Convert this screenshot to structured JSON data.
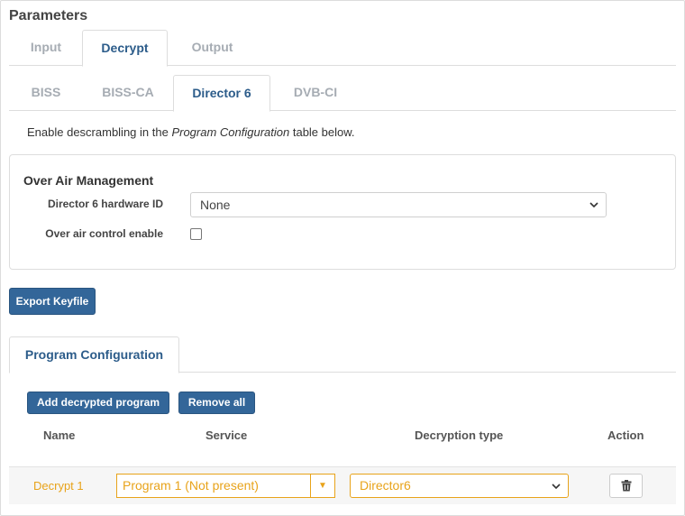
{
  "page": {
    "title": "Parameters"
  },
  "main_tabs": [
    {
      "label": "Input",
      "active": false
    },
    {
      "label": "Decrypt",
      "active": true
    },
    {
      "label": "Output",
      "active": false
    }
  ],
  "decrypt_tabs": [
    {
      "label": "BISS",
      "active": false
    },
    {
      "label": "BISS-CA",
      "active": false
    },
    {
      "label": "Director 6",
      "active": true
    },
    {
      "label": "DVB-CI",
      "active": false
    }
  ],
  "hint": {
    "before": "Enable descrambling in the ",
    "emphasis": "Program Configuration",
    "after": " table below."
  },
  "over_air": {
    "title": "Over Air Management",
    "hardware_id_label": "Director 6 hardware ID",
    "hardware_id_value": "None",
    "control_enable_label": "Over air control enable",
    "control_enable_checked": false
  },
  "buttons": {
    "export": "Export Keyfile",
    "add": "Add decrypted program",
    "remove_all": "Remove all"
  },
  "program_tab": {
    "label": "Program Configuration"
  },
  "table": {
    "headers": {
      "name": "Name",
      "service": "Service",
      "decryption_type": "Decryption type",
      "action": "Action"
    },
    "rows": [
      {
        "name": "Decrypt 1",
        "service": "Program 1 (Not present)",
        "decryption_type": "Director6",
        "action_icon": "trash-icon"
      }
    ]
  },
  "colors": {
    "accent": "#336699",
    "warning": "#e8a31a",
    "active_tab": "#2c5c8a"
  }
}
